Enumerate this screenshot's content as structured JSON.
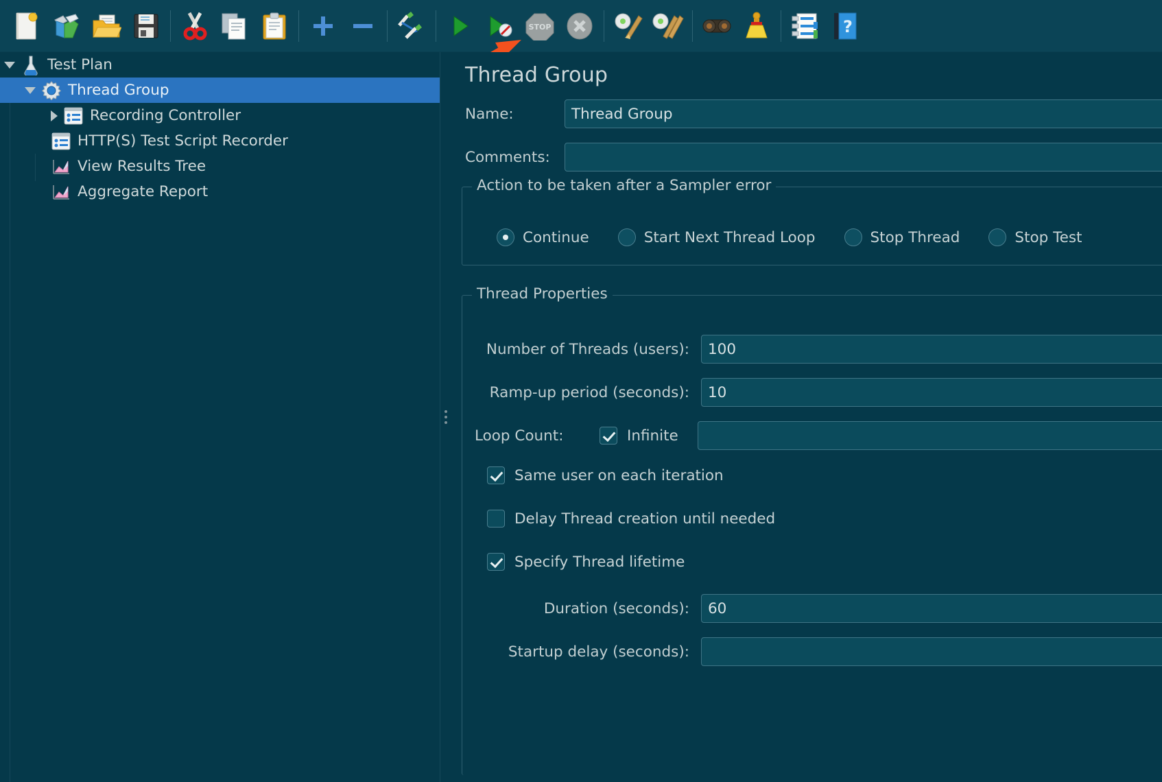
{
  "theme": {
    "bg": "#05394a",
    "toolbar_bg": "#0b4456",
    "selection_blue": "#2b74c0",
    "field_bg": "#0b4b5c",
    "field_border": "#3f7586",
    "text": "#c9d5d7",
    "arrow_accent": "#f4511e"
  },
  "toolbar": {
    "items": [
      {
        "name": "new-icon",
        "label": "New"
      },
      {
        "name": "templates-icon",
        "label": "Templates"
      },
      {
        "name": "open-icon",
        "label": "Open"
      },
      {
        "name": "save-icon",
        "label": "Save Test Plan"
      },
      {
        "name": "cut-icon",
        "label": "Cut"
      },
      {
        "name": "copy-icon",
        "label": "Copy"
      },
      {
        "name": "paste-icon",
        "label": "Paste"
      },
      {
        "name": "expand-all-icon",
        "label": "Expand All"
      },
      {
        "name": "collapse-all-icon",
        "label": "Collapse All"
      },
      {
        "name": "toggle-icon",
        "label": "Toggle"
      },
      {
        "name": "start-icon",
        "label": "Start"
      },
      {
        "name": "start-no-pauses-icon",
        "label": "Start no pauses"
      },
      {
        "name": "stop-icon",
        "label": "Stop"
      },
      {
        "name": "shutdown-icon",
        "label": "Shutdown"
      },
      {
        "name": "clear-icon",
        "label": "Clear"
      },
      {
        "name": "clear-all-icon",
        "label": "Clear All"
      },
      {
        "name": "search-icon",
        "label": "Search"
      },
      {
        "name": "reset-search-icon",
        "label": "Reset Search"
      },
      {
        "name": "function-helper-icon",
        "label": "Function Helper Dialog"
      },
      {
        "name": "help-icon",
        "label": "Help"
      }
    ]
  },
  "annotation": {
    "arrow_label": "red arrow pointing to Start button"
  },
  "tree": {
    "nodes": [
      {
        "label": "Test Plan",
        "icon": "test-plan-icon",
        "twist": "down",
        "indent": 0,
        "selected": false
      },
      {
        "label": "Thread Group",
        "icon": "thread-group-icon",
        "twist": "down",
        "indent": 1,
        "selected": true
      },
      {
        "label": "Recording Controller",
        "icon": "recording-controller-icon",
        "twist": "right",
        "indent": 2,
        "selected": false
      },
      {
        "label": "HTTP(S) Test Script Recorder",
        "icon": "http-script-recorder-icon",
        "twist": "none",
        "indent": 1,
        "selected": false
      },
      {
        "label": "View Results Tree",
        "icon": "view-results-tree-icon",
        "twist": "none",
        "indent": 1,
        "selected": false
      },
      {
        "label": "Aggregate Report",
        "icon": "aggregate-report-icon",
        "twist": "none",
        "indent": 1,
        "selected": false
      }
    ]
  },
  "panel": {
    "title": "Thread Group",
    "name_label": "Name:",
    "name_value": "Thread Group",
    "comments_label": "Comments:",
    "comments_value": "",
    "error_action": {
      "legend": "Action to be taken after a Sampler error",
      "options": [
        {
          "label": "Continue",
          "selected": true
        },
        {
          "label": "Start Next Thread Loop",
          "selected": false
        },
        {
          "label": "Stop Thread",
          "selected": false
        },
        {
          "label": "Stop Test",
          "selected": false
        }
      ]
    },
    "thread_properties": {
      "legend": "Thread Properties",
      "num_threads_label": "Number of Threads (users):",
      "num_threads_value": "100",
      "ramp_up_label": "Ramp-up period (seconds):",
      "ramp_up_value": "10",
      "loop_count_label": "Loop Count:",
      "loop_infinite_label": "Infinite",
      "loop_infinite_checked": true,
      "loop_count_value": "",
      "same_user_label": "Same user on each iteration",
      "same_user_checked": true,
      "delay_thread_label": "Delay Thread creation until needed",
      "delay_thread_checked": false,
      "specify_lifetime_label": "Specify Thread lifetime",
      "specify_lifetime_checked": true,
      "duration_label": "Duration (seconds):",
      "duration_value": "60",
      "startup_delay_label": "Startup delay (seconds):",
      "startup_delay_value": ""
    }
  }
}
